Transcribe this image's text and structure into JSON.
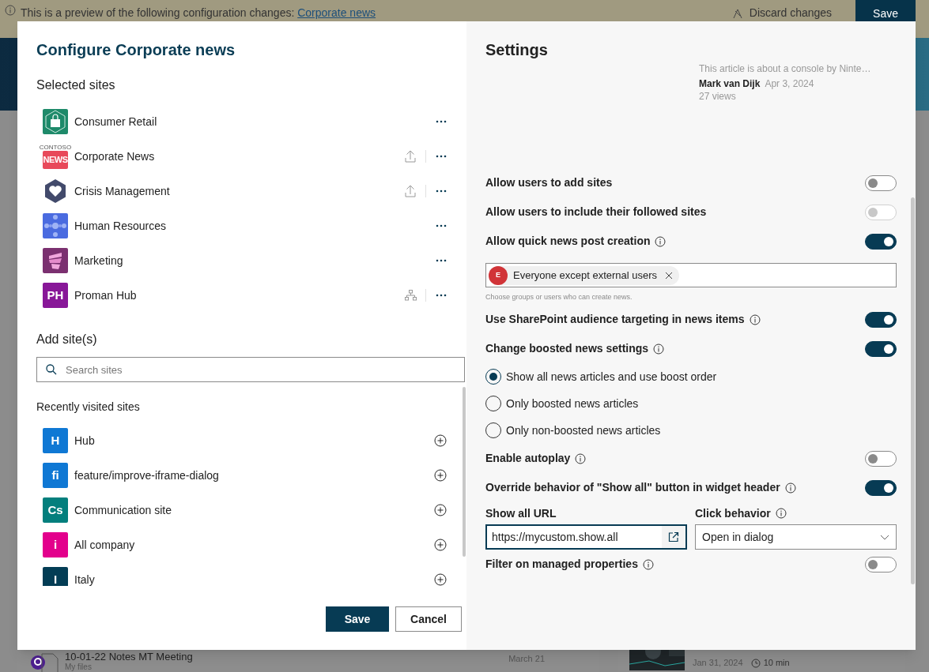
{
  "banner": {
    "message": "This is a preview of the following configuration changes:",
    "link": "Corporate news",
    "discard": "Discard changes",
    "save": "Save"
  },
  "background": {
    "file": {
      "name": "10-01-22 Notes MT Meeting",
      "location": "My files",
      "date": "March 21"
    },
    "video": {
      "date": "Jan 31, 2024",
      "duration": "10 min"
    }
  },
  "dialog": {
    "title": "Configure Corporate news",
    "selected_sites": {
      "heading": "Selected sites",
      "items": [
        {
          "name": "Consumer Retail",
          "kind": "retail",
          "promote": false,
          "hub": false
        },
        {
          "name": "Corporate News",
          "kind": "news",
          "logo_text": [
            "CONTOSO",
            "NEWS"
          ],
          "promote": true,
          "hub": false
        },
        {
          "name": "Crisis Management",
          "kind": "crisis",
          "promote": true,
          "hub": false
        },
        {
          "name": "Human Resources",
          "kind": "hr",
          "promote": false,
          "hub": false
        },
        {
          "name": "Marketing",
          "kind": "marketing",
          "promote": false,
          "hub": false
        },
        {
          "name": "Proman Hub",
          "kind": "initials",
          "initials": "PH",
          "color": "#881798",
          "promote": false,
          "hub": true
        }
      ]
    },
    "add_sites": {
      "heading": "Add site(s)",
      "search": {
        "placeholder": "Search sites"
      },
      "recent_heading": "Recently visited sites",
      "items": [
        {
          "name": "Hub",
          "initials": "H",
          "color": "#0f78d4"
        },
        {
          "name": "feature/improve-iframe-dialog",
          "initials": "fi",
          "color": "#0f78d4"
        },
        {
          "name": "Communication site",
          "initials": "Cs",
          "color": "#037f7d"
        },
        {
          "name": "All company",
          "initials": "i",
          "color": "#e3008c"
        },
        {
          "name": "Italy",
          "initials": "I",
          "color": "#033d55"
        }
      ]
    },
    "buttons": {
      "save": "Save",
      "cancel": "Cancel"
    }
  },
  "settings": {
    "title": "Settings",
    "article": {
      "summary": "This article is about a console by Ninte…",
      "author": "Mark van Dijk",
      "date": "Apr 3, 2024",
      "views": "27 views"
    },
    "items": [
      {
        "kind": "toggle",
        "label": "Allow users to add sites",
        "on": false,
        "disabled": false
      },
      {
        "kind": "toggle",
        "label": "Allow users to include their followed sites",
        "on": false,
        "disabled": true
      },
      {
        "kind": "toggle",
        "label": "Allow quick news post creation",
        "on": true,
        "disabled": false,
        "info": true
      },
      {
        "kind": "people",
        "chip": {
          "initial": "E",
          "label": "Everyone except external users",
          "color": "#d13438"
        },
        "hint": "Choose groups or users who can create news."
      },
      {
        "kind": "toggle",
        "label": "Use SharePoint audience targeting in news items",
        "on": true,
        "disabled": false,
        "info": true
      },
      {
        "kind": "toggle",
        "label": "Change boosted news settings",
        "on": true,
        "disabled": false,
        "info": true
      },
      {
        "kind": "radios",
        "options": [
          {
            "label": "Show all news articles and use boost order",
            "selected": true
          },
          {
            "label": "Only boosted news articles",
            "selected": false
          },
          {
            "label": "Only non-boosted news articles",
            "selected": false
          }
        ]
      },
      {
        "kind": "toggle",
        "label": "Enable autoplay",
        "on": false,
        "disabled": false,
        "info": true
      },
      {
        "kind": "toggle",
        "label": "Override behavior of \"Show all\" button in widget header",
        "on": true,
        "disabled": false,
        "info": true
      },
      {
        "kind": "fields",
        "url": {
          "label": "Show all URL",
          "value": "https://mycustom.show.all"
        },
        "behavior": {
          "label": "Click behavior",
          "value": "Open in dialog"
        }
      },
      {
        "kind": "toggle",
        "label": "Filter on managed properties",
        "on": false,
        "disabled": false,
        "info": true
      }
    ]
  }
}
